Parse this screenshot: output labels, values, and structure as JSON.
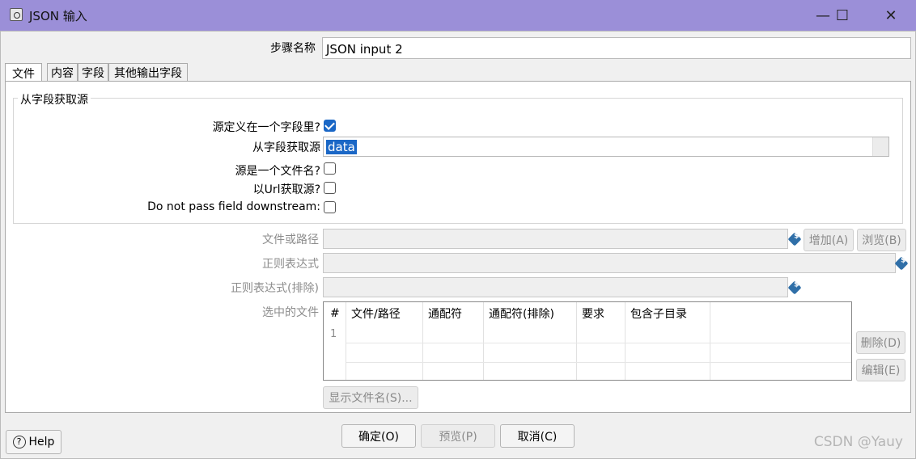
{
  "window": {
    "title": "JSON 输入",
    "minimize_glyph": "—",
    "maximize_glyph": "☐",
    "close_glyph": "✕"
  },
  "step": {
    "label": "步骤名称",
    "value": "JSON input 2"
  },
  "tabs": [
    {
      "label": "文件",
      "active": true
    },
    {
      "label": "内容",
      "active": false
    },
    {
      "label": "字段",
      "active": false
    },
    {
      "label": "其他输出字段",
      "active": false
    }
  ],
  "group": {
    "title": "从字段获取源",
    "source_in_field": {
      "label": "源定义在一个字段里?",
      "checked": true
    },
    "get_source_from_field": {
      "label": "从字段获取源",
      "value": "data"
    },
    "source_is_filename": {
      "label": "源是一个文件名?",
      "checked": false
    },
    "source_from_url": {
      "label": "以Url获取源?",
      "checked": false
    },
    "do_not_pass_field": {
      "label": "Do not pass field downstream:",
      "checked": false
    }
  },
  "file_section": {
    "file_or_dir_label": "文件或路径",
    "add_button": "增加(A)",
    "browse_button": "浏览(B)",
    "regex_label": "正则表达式",
    "regex_exclude_label": "正则表达式(排除)",
    "selected_files_label": "选中的文件",
    "table_headers": [
      "#",
      "文件/路径",
      "通配符",
      "通配符(排除)",
      "要求",
      "包含子目录"
    ],
    "row_numbers": [
      "1"
    ],
    "delete_button": "删除(D)",
    "edit_button": "编辑(E)",
    "show_filenames_button": "显示文件名(S)..."
  },
  "footer": {
    "help_button": "Help",
    "ok_button": "确定(O)",
    "preview_button": "预览(P)",
    "cancel_button": "取消(C)"
  },
  "watermark": "CSDN @Yauy",
  "colors": {
    "titlebar": "#9b8fd8",
    "checkbox_checked": "#1a67c6",
    "selection": "#1a67c6"
  }
}
